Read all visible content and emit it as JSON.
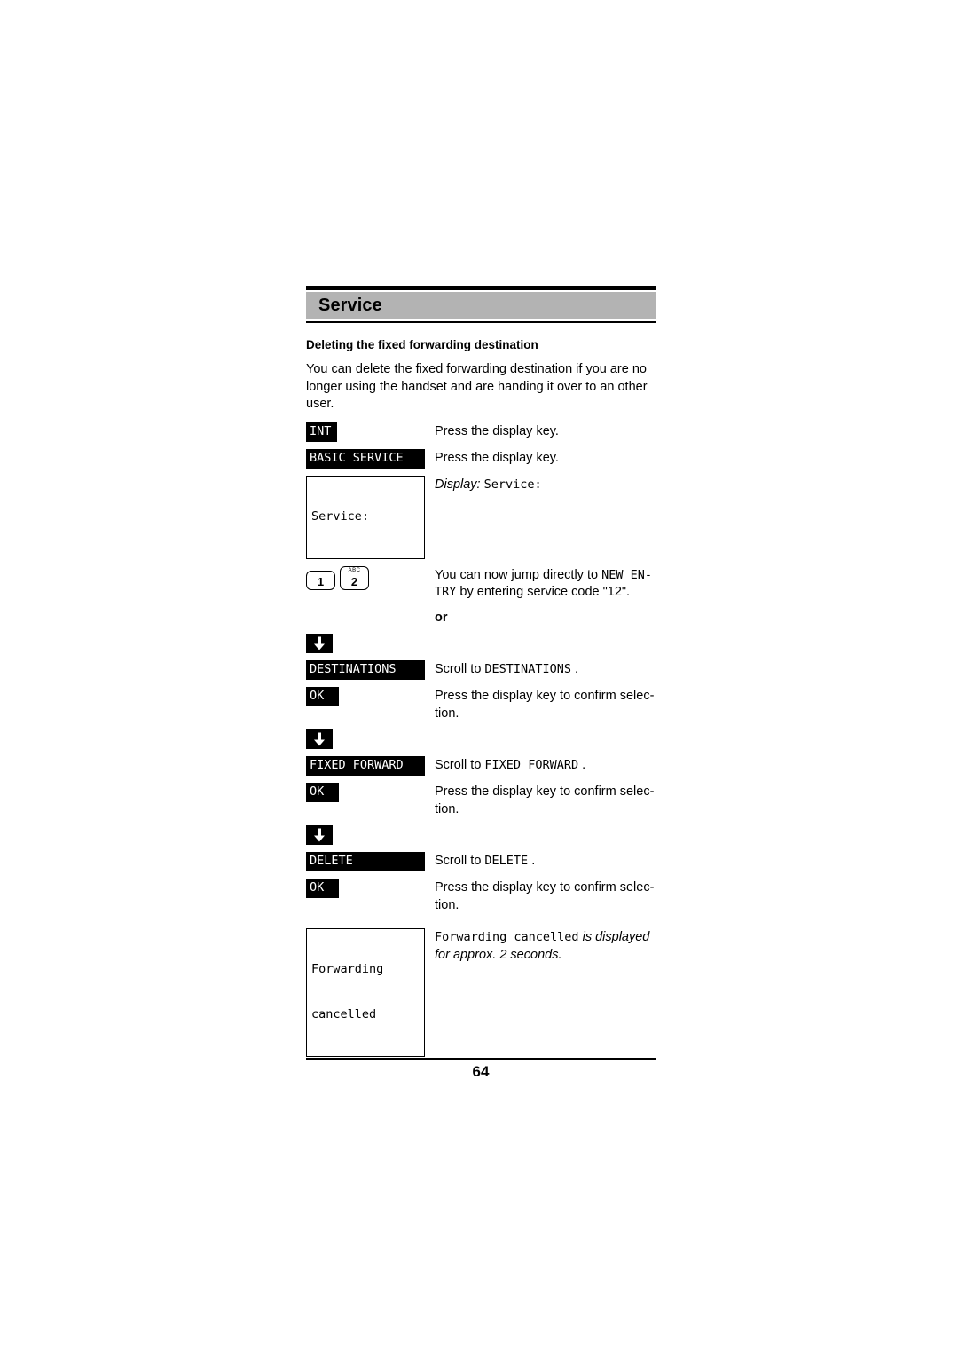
{
  "header": {
    "title": "Service"
  },
  "section": {
    "heading": "Deleting the fixed forwarding destination",
    "intro": "You can delete the fixed forwarding destination if you are no longer using the handset and are handing it over to an other user."
  },
  "steps": [
    {
      "key_type": "inverse",
      "key_label": "INT",
      "key_width": "int",
      "text": "Press the display key."
    },
    {
      "key_type": "inverse",
      "key_label": "BASIC SERVICE",
      "key_width": "wide",
      "text": "Press the display key."
    },
    {
      "key_type": "lcd",
      "lcd_lines": [
        "Service:"
      ],
      "text_prefix_italic": "Display:",
      "text_mono": "Service:"
    },
    {
      "key_type": "keypad",
      "keys": [
        {
          "digit": "1",
          "letters": ""
        },
        {
          "digit": "2",
          "letters": "ABC"
        }
      ],
      "text_a": "You can now jump directly to ",
      "text_mono": "NEW EN-",
      "text_b": "TRY",
      "text_c": " by entering service code \"12\"."
    },
    {
      "key_type": "or",
      "or_label": "or"
    },
    {
      "key_type": "arrow",
      "arrow": "arrow-down-icon",
      "text": ""
    },
    {
      "key_type": "inverse",
      "key_label": "DESTINATIONS",
      "key_width": "wide",
      "text_a": "Scroll to ",
      "text_mono": "DESTINATIONS",
      "text_c": " ."
    },
    {
      "key_type": "inverse",
      "key_label": "OK",
      "key_width": "ok",
      "text": "Press the display key to confirm selection."
    },
    {
      "key_type": "arrow",
      "arrow": "arrow-down-icon",
      "text": ""
    },
    {
      "key_type": "inverse",
      "key_label": "FIXED FORWARD",
      "key_width": "wide",
      "text_a": "Scroll to ",
      "text_mono": "FIXED FORWARD",
      "text_c": " ."
    },
    {
      "key_type": "inverse",
      "key_label": "OK",
      "key_width": "ok",
      "text": "Press the display key to confirm selection."
    },
    {
      "key_type": "arrow",
      "arrow": "arrow-down-icon",
      "text": ""
    },
    {
      "key_type": "inverse",
      "key_label": "DELETE",
      "key_width": "wide",
      "text_a": "Scroll to ",
      "text_mono": "DELETE",
      "text_c": " ."
    },
    {
      "key_type": "inverse",
      "key_label": "OK",
      "key_width": "ok",
      "text": "Press the display key to confirm selection."
    },
    {
      "key_type": "lcd2",
      "lcd_lines": [
        "Forwarding",
        "cancelled"
      ],
      "text_mono": "Forwarding cancelled",
      "text_italic": " is displayed for approx. 2 seconds."
    }
  ],
  "step_text": {
    "press_display_key": "Press the display key.",
    "press_confirm_1": "Press the display key to confirm selec-",
    "press_confirm_2": "tion.",
    "jump_line1_a": "You can now jump directly to ",
    "jump_line1_mono": "NEW EN-",
    "jump_line2_mono": "TRY",
    "jump_line2_b": " by entering service code \"12\".",
    "or": "or",
    "scroll_to": "Scroll to ",
    "period": " .",
    "display_label": "Display:",
    "display_value": "Service:",
    "cancelled_mono": "Forwarding cancelled",
    "cancelled_italic_1": " is displayed",
    "cancelled_italic_2": "for approx. 2 seconds."
  },
  "keys": {
    "int": "INT",
    "basic_service": "BASIC SERVICE",
    "destinations": "DESTINATIONS",
    "fixed_forward": "FIXED FORWARD",
    "delete": "DELETE",
    "ok": "OK",
    "digit_1": "1",
    "digit_2": "2",
    "digit_2_letters": "ABC"
  },
  "lcd": {
    "service_line": "Service:",
    "forwarding_line1": "Forwarding",
    "forwarding_line2": "cancelled"
  },
  "footer": {
    "page_number": "64"
  },
  "colors": {
    "header_band": "#b3b3b3",
    "rule": "#000000",
    "paper": "#ffffff"
  }
}
